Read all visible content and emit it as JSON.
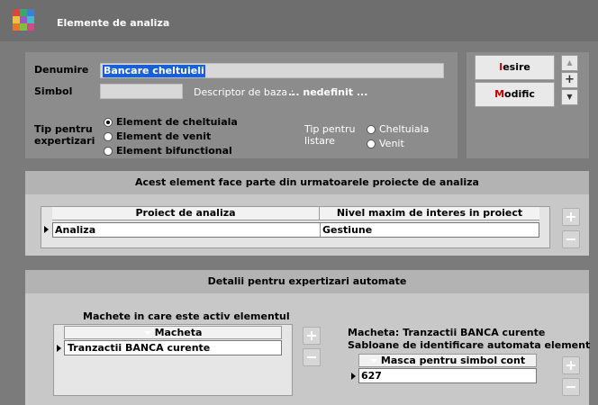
{
  "window": {
    "title": "Elemente de analiza",
    "icon": "app-grid-icon",
    "colors": {
      "icon": [
        "#d9483b",
        "#3aa86b",
        "#3b7fd9",
        "#e8c43a",
        "#9c56c9",
        "#47b9c4",
        "#e07a32",
        "#7fbf3f",
        "#c94d87"
      ]
    }
  },
  "form": {
    "denumire_label": "Denumire",
    "denumire_value": "Bancare cheltuieli",
    "simbol_label": "Simbol",
    "simbol_value": "",
    "descriptor_label": "Descriptor de baza :",
    "descriptor_value": "... nedefinit ...",
    "tip_expertizari_label_1": "Tip pentru",
    "tip_expertizari_label_2": "expertizari",
    "tip_expertizari_options": [
      "Element de cheltuiala",
      "Element de venit",
      "Element bifunctional"
    ],
    "tip_expertizari_selected": 0,
    "tip_listare_label_1": "Tip pentru",
    "tip_listare_label_2": "listare",
    "tip_listare_options": [
      "Cheltuiala",
      "Venit"
    ]
  },
  "buttons": {
    "iesire_hot": "I",
    "iesire_rest": "esire",
    "modific_hot": "M",
    "modific_rest": "odific",
    "spin_up": "▲",
    "spin_add": "+",
    "spin_down": "▼"
  },
  "section_projects": {
    "heading": "Acest element face parte din urmatoarele proiecte de analiza",
    "columns": [
      "Proiect de analiza",
      "Nivel maxim de interes in proiect"
    ],
    "rows": [
      {
        "proiect": "Analiza",
        "nivel": "Gestiune"
      }
    ]
  },
  "section_details": {
    "heading": "Detalii pentru expertizari automate",
    "machete_title": "Machete in care este activ elementul",
    "machete_column": "Macheta",
    "machete_rows": [
      "Tranzactii BANCA curente"
    ],
    "macheta_info": "Macheta:  Tranzactii BANCA curente",
    "sabloane_title": "Sabloane de identificare automata element",
    "masca_column": "Masca pentru simbol cont",
    "masca_rows": [
      "627"
    ]
  }
}
